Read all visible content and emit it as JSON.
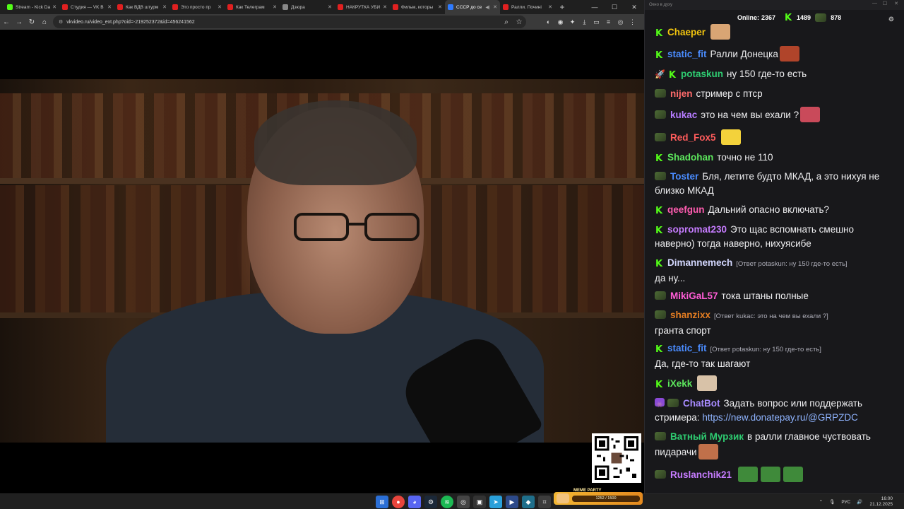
{
  "browser": {
    "tabs": [
      {
        "label": "Stream - Kick Da",
        "color": "#53fc18",
        "active": false
      },
      {
        "label": "Студия — VK В",
        "color": "#e02020",
        "active": false
      },
      {
        "label": "Как ВДВ штурм",
        "color": "#e02020",
        "active": false
      },
      {
        "label": "Это просто пр",
        "color": "#e02020",
        "active": false
      },
      {
        "label": "Как Телеграм",
        "color": "#e02020",
        "active": false
      },
      {
        "label": "Дзюра",
        "color": "#888888",
        "active": false
      },
      {
        "label": "НАКРУТКА УБИ",
        "color": "#e02020",
        "active": false
      },
      {
        "label": "Фильм, которы",
        "color": "#e02020",
        "active": false
      },
      {
        "label": "СССР до се",
        "color": "#2f7bff",
        "active": true
      },
      {
        "label": "Ралли. Почині",
        "color": "#e02020",
        "active": false
      }
    ],
    "url": "vkvideo.ru/video_ext.php?oid=-219252372&id=456241562",
    "window_controls": {
      "minimize": "—",
      "maximize": "☐",
      "close": "✕"
    }
  },
  "chat": {
    "window_title": "Окно в духу",
    "online_label": "Online:",
    "online_count": "2367",
    "kick_count": "1489",
    "platform_count": "878",
    "messages": [
      {
        "badges": [
          "kick"
        ],
        "user": "Chaeper",
        "color": "#f1c40f",
        "text": "",
        "emote": "#d9a574"
      },
      {
        "badges": [
          "kick"
        ],
        "user": "static_fit",
        "color": "#4a8cff",
        "text": "Ралли Донецка",
        "emote": "#b0442a"
      },
      {
        "badges": [
          "rocket",
          "kick"
        ],
        "user": "potaskun",
        "color": "#2ecc71",
        "text": "ну 150 где-то есть"
      },
      {
        "badges": [
          "pepe"
        ],
        "user": "nijen",
        "color": "#ff6b6b",
        "text": "стример с птср"
      },
      {
        "badges": [
          "pepe"
        ],
        "user": "kukac",
        "color": "#b57bff",
        "text": "это на чем вы ехали ?",
        "emote": "#c94a5a"
      },
      {
        "badges": [
          "pepe"
        ],
        "user": "Red_Fox5",
        "color": "#ff5c5c",
        "text": "",
        "emote": "#f3d23b"
      },
      {
        "badges": [
          "kick"
        ],
        "user": "Shadohan",
        "color": "#5de85d",
        "text": "точно не 110"
      },
      {
        "badges": [
          "pepe"
        ],
        "user": "Toster",
        "color": "#4a8cff",
        "text": "Бля, летите будто МКАД, а это нихуя не близко МКАД"
      },
      {
        "badges": [
          "kick"
        ],
        "user": "qeefgun",
        "color": "#ff5cb0",
        "text": "Дальний опасно включать?"
      },
      {
        "badges": [
          "kick"
        ],
        "user": "sopromat230",
        "color": "#c67cff",
        "text": "Это щас вспомнать смешно наверно) тогда наверно, нихуясибе"
      },
      {
        "badges": [
          "kick"
        ],
        "user": "Dimannemech",
        "color": "#d4d8ff",
        "reply": "[Ответ potaskun: ну 150 где-то есть]",
        "text": "да ну..."
      },
      {
        "badges": [
          "pepe"
        ],
        "user": "MikiGaL57",
        "color": "#ff5cd6",
        "text": "тока штаны полные"
      },
      {
        "badges": [
          "pepe"
        ],
        "user": "shanzixx",
        "color": "#e67e22",
        "reply": "[Ответ kukac: это на чем вы ехали ?]",
        "text": "гранта спорт"
      },
      {
        "badges": [
          "kick"
        ],
        "user": "static_fit",
        "color": "#4a8cff",
        "reply": "[Ответ potaskun: ну 150 где-то есть]",
        "text": "Да, где-то так шагают"
      },
      {
        "badges": [
          "kick"
        ],
        "user": "iXekk",
        "color": "#5de85d",
        "text": "",
        "emote": "#d8c2a8"
      },
      {
        "badges": [
          "bot",
          "pepe"
        ],
        "user": "ChatBot",
        "color": "#a78bff",
        "text": "Задать вопрос или поддержать стримера:",
        "link": "https://new.donatepay.ru/@GRPZDC"
      },
      {
        "badges": [
          "pepe"
        ],
        "user": "Ватный Мурзик",
        "color": "#2ecc71",
        "text": "в ралли главное чуствовать пидарачи",
        "emote": "#c0704a"
      },
      {
        "badges": [
          "pepe"
        ],
        "user": "Ruslanchik21",
        "color": "#c67cff",
        "text": "",
        "emotes3": "#3f8a3a"
      }
    ]
  },
  "taskbar": {
    "meme_party_title": "MEME PARTY",
    "meme_party_progress": "1252 / 1500",
    "lang": "РУС",
    "time": "16:00",
    "date": "21.12.2025"
  }
}
